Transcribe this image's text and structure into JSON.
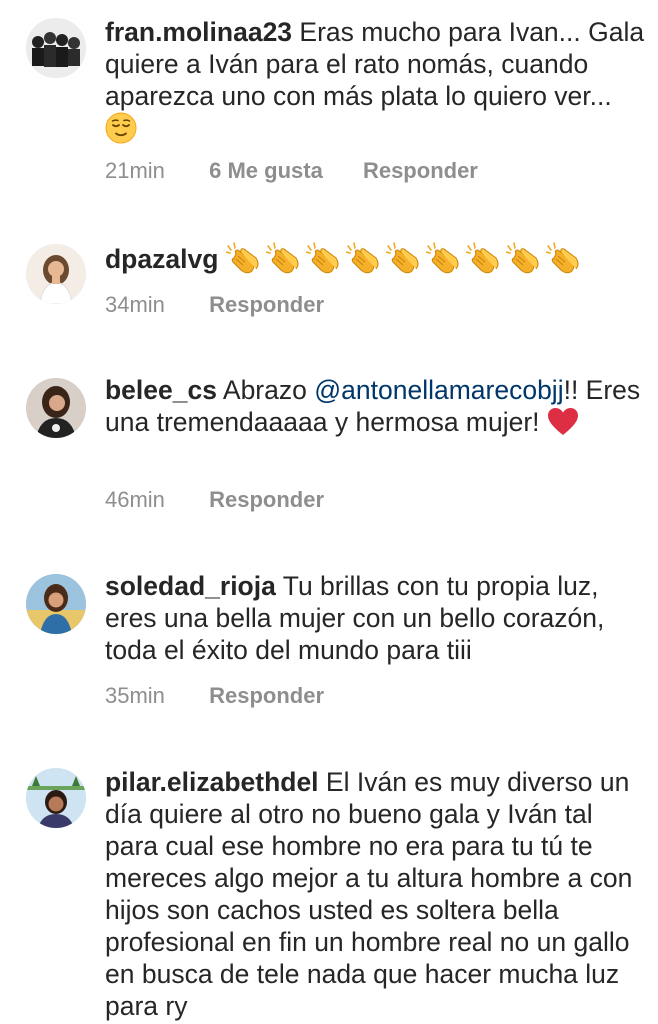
{
  "comments": [
    {
      "username": "fran.molinaa23",
      "text": "Eras mucho para Ivan... Gala quiere a Iván para el rato nomás, cuando aparezca uno con más plata lo quiero ver...",
      "emoji": "relieved-face",
      "time": "21min",
      "likes": "6 Me gusta",
      "reply": "Responder"
    },
    {
      "username": "dpazalvg",
      "text": "",
      "emoji": "clapping-hands",
      "emoji_count": 9,
      "time": "34min",
      "reply": "Responder"
    },
    {
      "username": "belee_cs",
      "text_before": "Abrazo",
      "mention": "@antonellamarecobjj",
      "text_after": "!! Eres una tremendaaaaa y hermosa mujer!",
      "emoji": "red-heart",
      "time": "46min",
      "reply": "Responder"
    },
    {
      "username": "soledad_rioja",
      "text": "Tu brillas con tu propia luz, eres una bella mujer con un bello corazón, toda el éxito del mundo para tiii",
      "time": "35min",
      "reply": "Responder"
    },
    {
      "username": "pilar.elizabethdel",
      "text": "El Iván es muy diverso un día quiere al otro no bueno gala y Iván tal para cual ese hombre no era para tu tú te mereces algo mejor a tu altura hombre a con hijos son cachos usted es soltera bella profesional en fin un hombre real no un gallo en busca de tele nada que hacer mucha luz para ry"
    }
  ]
}
